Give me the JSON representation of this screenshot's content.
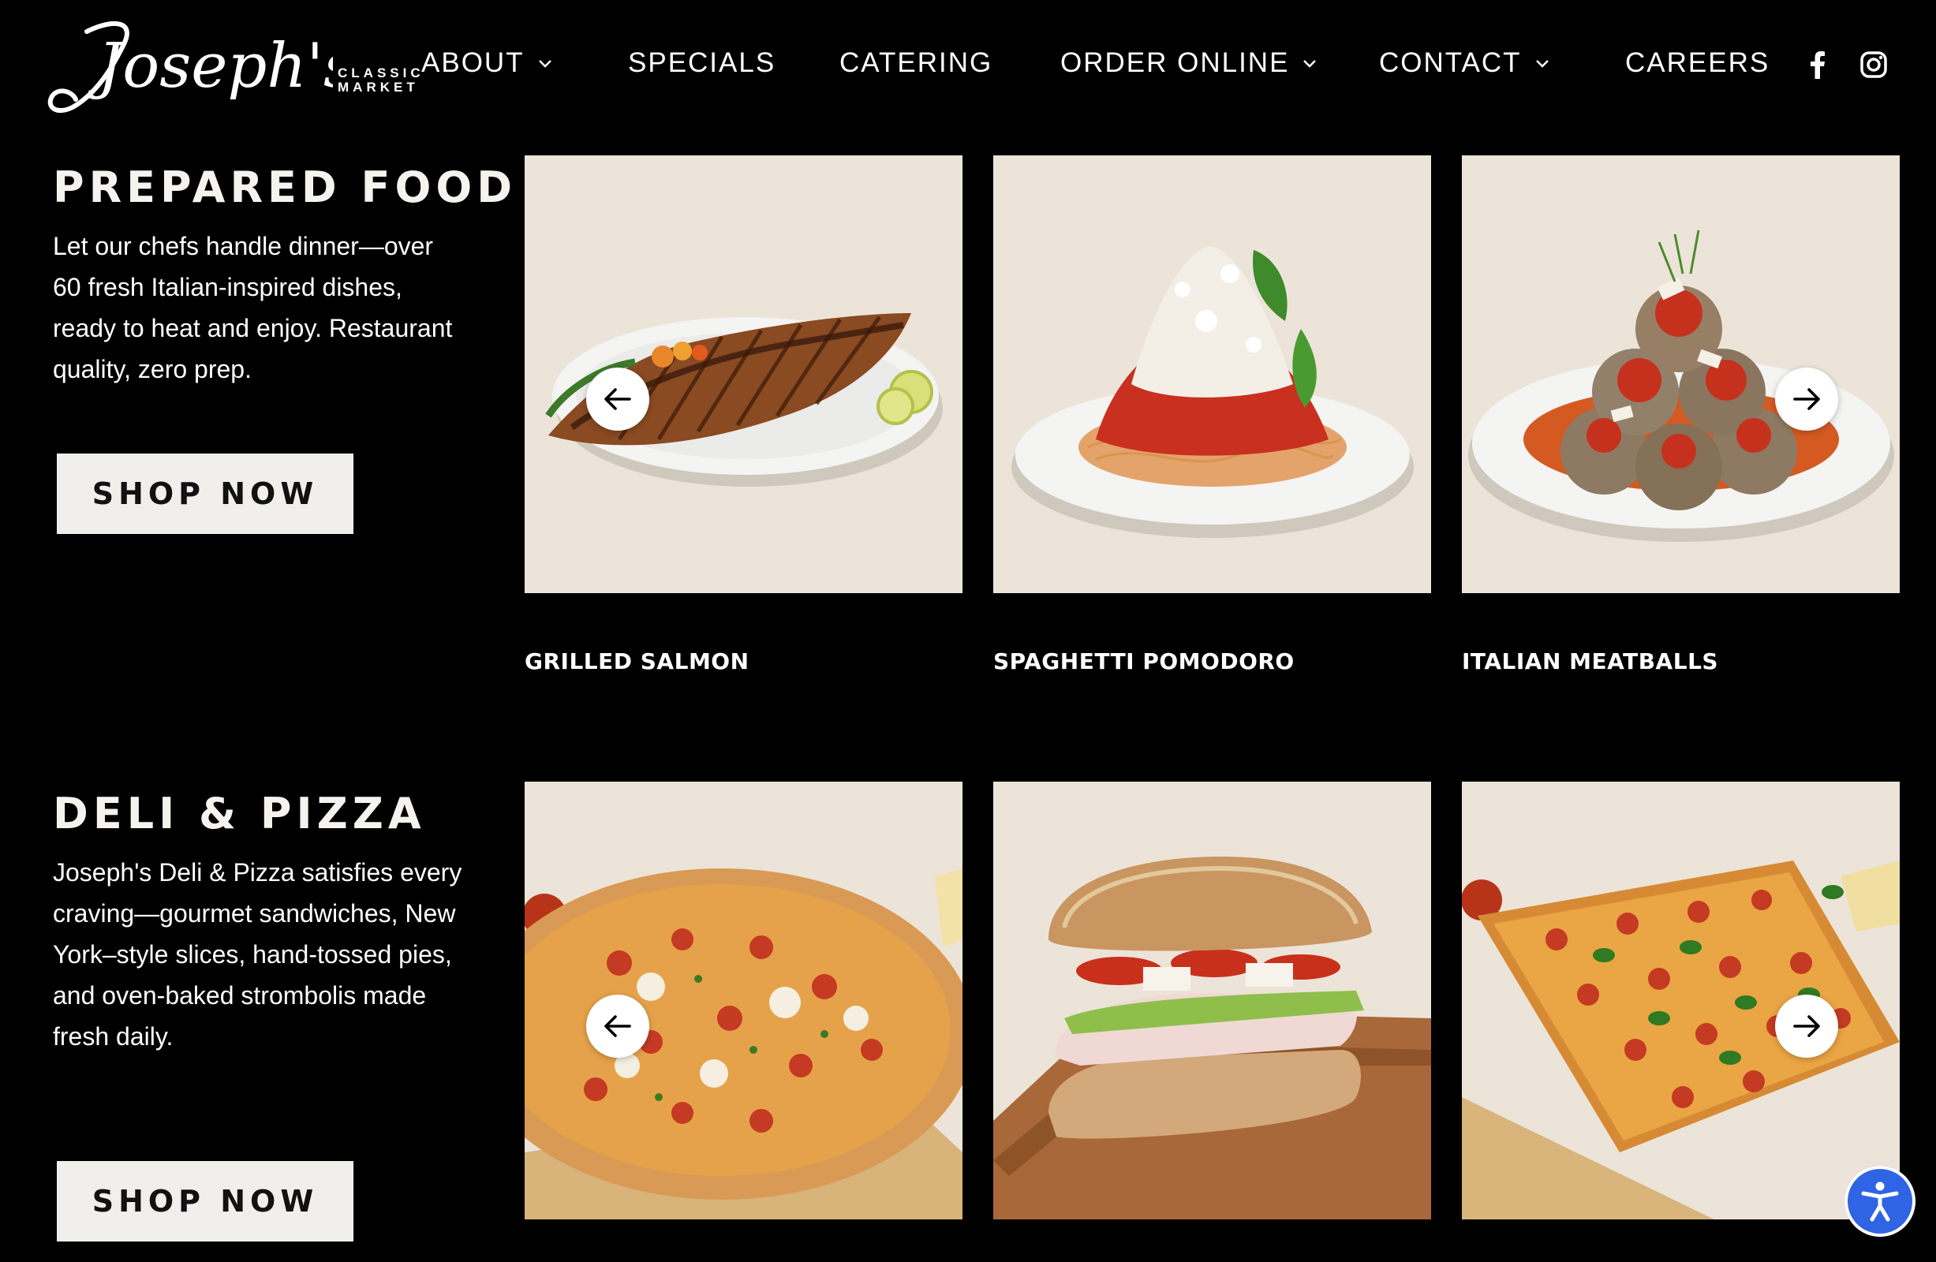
{
  "brand": {
    "logo_script": "Joseph's",
    "logo_sub_line1": "CLASSIC",
    "logo_sub_line2": "MARKET"
  },
  "nav": {
    "items": [
      {
        "label": "ABOUT",
        "dropdown": true
      },
      {
        "label": "SPECIALS",
        "dropdown": false
      },
      {
        "label": "CATERING",
        "dropdown": false
      },
      {
        "label": "ORDER ONLINE",
        "dropdown": true
      },
      {
        "label": "CONTACT",
        "dropdown": true
      },
      {
        "label": "CAREERS",
        "dropdown": false
      }
    ],
    "social": [
      "facebook-icon",
      "instagram-icon"
    ]
  },
  "sections": [
    {
      "title": "PREPARED FOOD",
      "description": "Let our chefs handle dinner—over 60 fresh Italian-inspired dishes, ready to heat and enjoy. Restaurant quality, zero prep.",
      "button": "SHOP NOW",
      "items": [
        "GRILLED SALMON",
        "SPAGHETTI POMODORO",
        "ITALIAN MEATBALLS"
      ]
    },
    {
      "title": "DELI & PIZZA",
      "description": "Joseph's Deli & Pizza satisfies every craving—gourmet sandwiches, New York–style slices, hand-tossed pies, and oven-baked strombolis made fresh daily.",
      "button": "SHOP NOW",
      "items": []
    }
  ],
  "colors": {
    "background": "#000000",
    "button_bg": "#f1efeb",
    "card_bg": "#ece4d8",
    "accessibility_blue": "#2f64e4"
  },
  "icons": {
    "prev": "arrow-left-icon",
    "next": "arrow-right-icon",
    "accessibility": "accessibility-icon"
  }
}
